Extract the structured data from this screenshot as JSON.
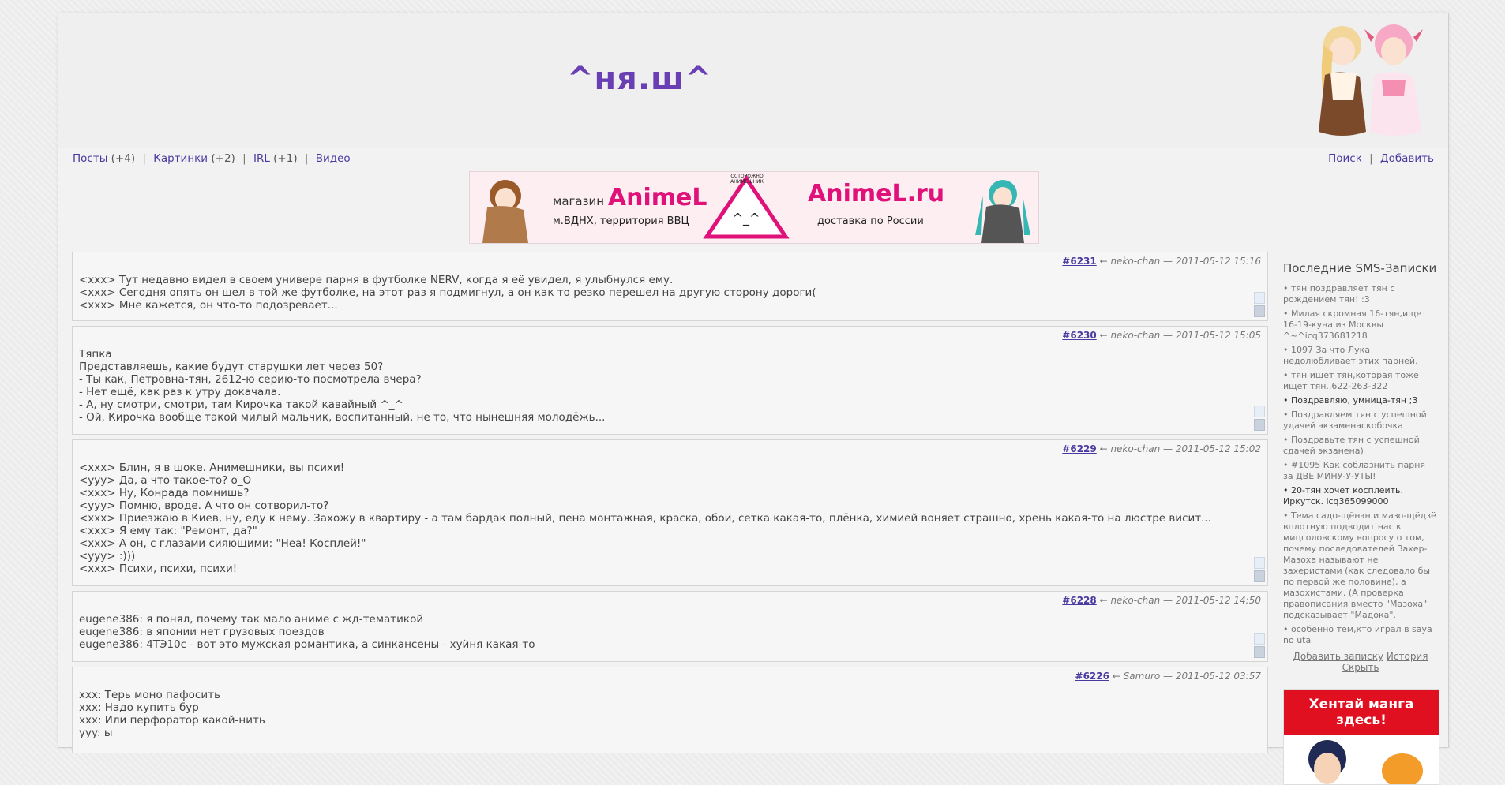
{
  "logo": "^ня.ш^",
  "nav": {
    "left": [
      {
        "label": "Посты",
        "count": "(+4)"
      },
      {
        "label": "Картинки",
        "count": "(+2)"
      },
      {
        "label": "IRL",
        "count": "(+1)"
      },
      {
        "label": "Видео",
        "count": ""
      }
    ],
    "right": [
      {
        "label": "Поиск"
      },
      {
        "label": "Добавить"
      }
    ]
  },
  "banner": {
    "shop": "магазин",
    "brand": "AnimeL",
    "address": "м.ВДНХ, территория ВВЦ",
    "sign": "ОСТОРОЖНО АНИМЕШНИК",
    "face": "^_^",
    "site": "AnimeL.ru",
    "delivery": "доставка по России"
  },
  "posts": [
    {
      "id": "#6231",
      "author": "neko-chan",
      "date": "2011-05-12 15:16",
      "body": "<xxx> Тут недавно видел в своем универе парня в футболке NERV, когда я её увидел, я улыбнулся ему.\n<xxx> Сегодня опять он шел в той же футболке, на этот раз я подмигнул, а он как то резко перешел на другую сторону дороги(\n<xxx> Мне кажется, он что-то подозревает..."
    },
    {
      "id": "#6230",
      "author": "neko-chan",
      "date": "2011-05-12 15:05",
      "body": "Тяпка\nПредставляешь, какие будут старушки лет через 50?\n- Ты как, Петровна-тян, 2612-ю серию-то посмотрела вчера?\n- Нет ещё, как раз к утру докачала.\n- А, ну смотри, смотри, там Кирочка такой кавайный ^_^\n- Ой, Кирочка вообще такой милый мальчик, воспитанный, не то, что нынешняя молодёжь..."
    },
    {
      "id": "#6229",
      "author": "neko-chan",
      "date": "2011-05-12 15:02",
      "body": "<xxx> Блин, я в шоке. Анимешники, вы психи!\n<yyy> Да, а что такое-то? о_О\n<xxx> Ну, Конрада помнишь?\n<yyy> Помню, вроде. А что он сотворил-то?\n<xxx> Приезжаю в Киев, ну, еду к нему. Захожу в квартиру - а там бардак полный, пена монтажная, краска, обои, сетка какая-то, плёнка, химией воняет страшно, хрень какая-то на люстре висит...\n<xxx> Я ему так: \"Ремонт, да?\"\n<xxx> А он, с глазами сияющими: \"Неа! Косплей!\"\n<yyy> :)))\n<xxx> Психи, психи, психи!"
    },
    {
      "id": "#6228",
      "author": "neko-chan",
      "date": "2011-05-12 14:50",
      "body": "eugene386: я понял, почему так мало аниме с жд-тематикой\neugene386: в японии нет грузовых поездов\neugene386: 4ТЭ10с - вот это мужская романтика, а синкансены - хуйня какая-то"
    },
    {
      "id": "#6226",
      "author": "Samuro",
      "date": "2011-05-12 03:57",
      "body": "xxx: Терь моно пафосить\nxxx: Надо купить бур\nxxx: Или перфоратор какой-нить\nyyy: ы"
    }
  ],
  "sidebar": {
    "title": "Последние SMS-Записки",
    "items": [
      {
        "text": "• тян поздравляет тян с рождением тян! :3",
        "bold": false
      },
      {
        "text": "• Милая скромная 16-тян,ищет 16-19-куна из Москвы ^~^icq373681218",
        "bold": false
      },
      {
        "text": "• 1097 За что Лука недолюбливает этих парней.",
        "bold": false
      },
      {
        "text": "• тян ищет тян,которая тоже ищет тян..622-263-322",
        "bold": false
      },
      {
        "text": "• Поздравляю, умница-тян ;3",
        "bold": true
      },
      {
        "text": "• Поздравляем тян с успешной удачей экзаменаскобочка",
        "bold": false
      },
      {
        "text": "• Поздравьте тян с успешной сдачей экзанена)",
        "bold": false
      },
      {
        "text": "• #1095 Как соблазнить парня за ДВЕ МИНУ-У-УТЫ!",
        "bold": false
      },
      {
        "text": "• 20-тян хочет косплеить. Иркутск. icq365099000",
        "bold": true
      },
      {
        "text": "• Тема садо-щёнэн и мазо-щёдзё вплотную подводит нас к мицголовскому вопросу о том, почему последователей Захер-Мазоха называют не захеристами (как следовало бы по первой же половине), а мазохистами. (А проверка правописания вместо \"Мазоха\" подсказывает \"Мадока\".",
        "bold": false
      },
      {
        "text": "• особенно тем,кто играл в saya no uta",
        "bold": false
      }
    ],
    "add_label": "Добавить записку",
    "history_label": "История",
    "hide_label": "Скрыть",
    "ad_title": "Хентай манга здесь!"
  }
}
